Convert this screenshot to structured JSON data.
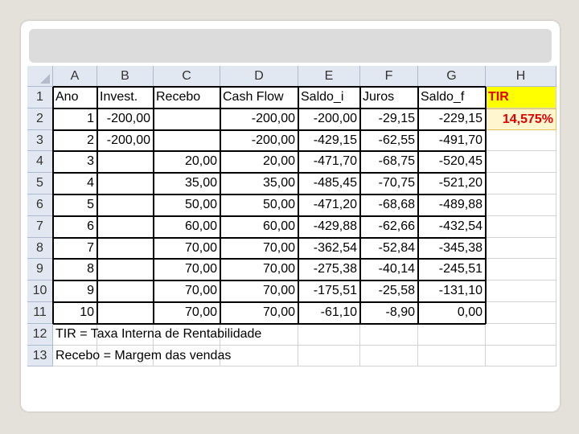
{
  "columns": [
    "A",
    "B",
    "C",
    "D",
    "E",
    "F",
    "G",
    "H"
  ],
  "rows": [
    {
      "num": "1",
      "cells": [
        "Ano",
        "Invest.",
        "Recebo",
        "Cash Flow",
        "Saldo_i",
        "Juros",
        "Saldo_f",
        "TIR"
      ]
    },
    {
      "num": "2",
      "cells": [
        "1",
        "-200,00",
        "",
        "-200,00",
        "-200,00",
        "-29,15",
        "-229,15",
        "14,575%"
      ]
    },
    {
      "num": "3",
      "cells": [
        "2",
        "-200,00",
        "",
        "-200,00",
        "-429,15",
        "-62,55",
        "-491,70",
        ""
      ]
    },
    {
      "num": "4",
      "cells": [
        "3",
        "",
        "20,00",
        "20,00",
        "-471,70",
        "-68,75",
        "-520,45",
        ""
      ]
    },
    {
      "num": "5",
      "cells": [
        "4",
        "",
        "35,00",
        "35,00",
        "-485,45",
        "-70,75",
        "-521,20",
        ""
      ]
    },
    {
      "num": "6",
      "cells": [
        "5",
        "",
        "50,00",
        "50,00",
        "-471,20",
        "-68,68",
        "-489,88",
        ""
      ]
    },
    {
      "num": "7",
      "cells": [
        "6",
        "",
        "60,00",
        "60,00",
        "-429,88",
        "-62,66",
        "-432,54",
        ""
      ]
    },
    {
      "num": "8",
      "cells": [
        "7",
        "",
        "70,00",
        "70,00",
        "-362,54",
        "-52,84",
        "-345,38",
        ""
      ]
    },
    {
      "num": "9",
      "cells": [
        "8",
        "",
        "70,00",
        "70,00",
        "-275,38",
        "-40,14",
        "-245,51",
        ""
      ]
    },
    {
      "num": "10",
      "cells": [
        "9",
        "",
        "70,00",
        "70,00",
        "-175,51",
        "-25,58",
        "-131,10",
        ""
      ]
    },
    {
      "num": "11",
      "cells": [
        "10",
        "",
        "70,00",
        "70,00",
        "-61,10",
        "-8,90",
        "0,00",
        ""
      ]
    },
    {
      "num": "12",
      "cells": [
        "",
        "",
        "",
        "",
        "",
        "",
        "",
        ""
      ]
    },
    {
      "num": "13",
      "cells": [
        "",
        "",
        "",
        "",
        "",
        "",
        "",
        ""
      ]
    }
  ],
  "notes": {
    "row12": "TIR =  Taxa Interna de Rentabilidade",
    "row13": "Recebo = Margem das vendas"
  },
  "colors": {
    "tir_highlight": "#ffff00",
    "tir_text": "#e00000",
    "header_bg": "#e2e8f2"
  }
}
